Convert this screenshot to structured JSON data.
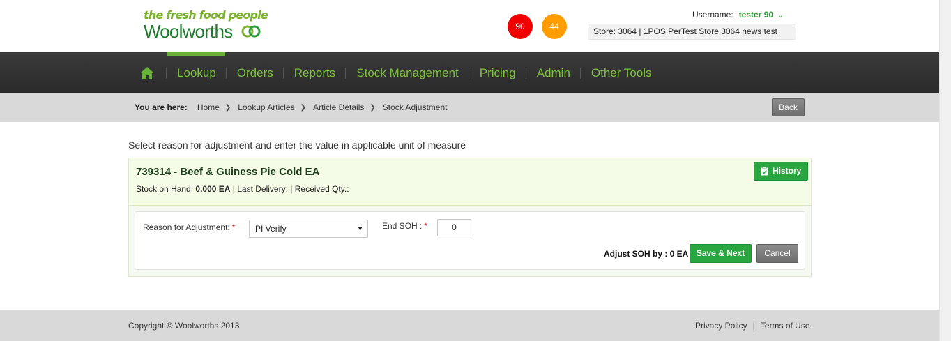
{
  "header": {
    "tagline": "the fresh food people",
    "brand": "Woolworths",
    "badge_red": "90",
    "badge_orange": "44",
    "username_label": "Username:",
    "username": "tester 90",
    "store": "Store: 3064 | 1POS PerTest Store 3064 news test"
  },
  "nav": {
    "items": [
      "Lookup",
      "Orders",
      "Reports",
      "Stock Management",
      "Pricing",
      "Admin",
      "Other Tools"
    ],
    "active": "Lookup"
  },
  "breadcrumb": {
    "prefix": "You are here:",
    "items": [
      "Home",
      "Lookup Articles",
      "Article Details",
      "Stock Adjustment"
    ],
    "back_label": "Back"
  },
  "main": {
    "instruction": "Select reason for adjustment and enter the value in applicable unit of measure",
    "article_title": "739314 - Beef & Guiness Pie Cold EA",
    "soh_label": "Stock on Hand:",
    "soh_value": "0.000 EA",
    "meta_rest": "| Last Delivery: | Received Qty.:",
    "history_label": "History",
    "reason_label": "Reason for Adjustment:",
    "reason_selected": "PI Verify",
    "end_soh_label": "End SOH :",
    "end_soh_value": "0",
    "adjust_text": "Adjust SOH by : 0 EA",
    "save_label": "Save & Next",
    "cancel_label": "Cancel"
  },
  "footer": {
    "copyright": "Copyright © Woolworths 2013",
    "privacy": "Privacy Policy",
    "terms": "Terms of Use"
  },
  "colors": {
    "accent_green": "#2aa640",
    "nav_text": "#7cc243",
    "badge_red": "#f20000",
    "badge_orange": "#ff9c00"
  }
}
